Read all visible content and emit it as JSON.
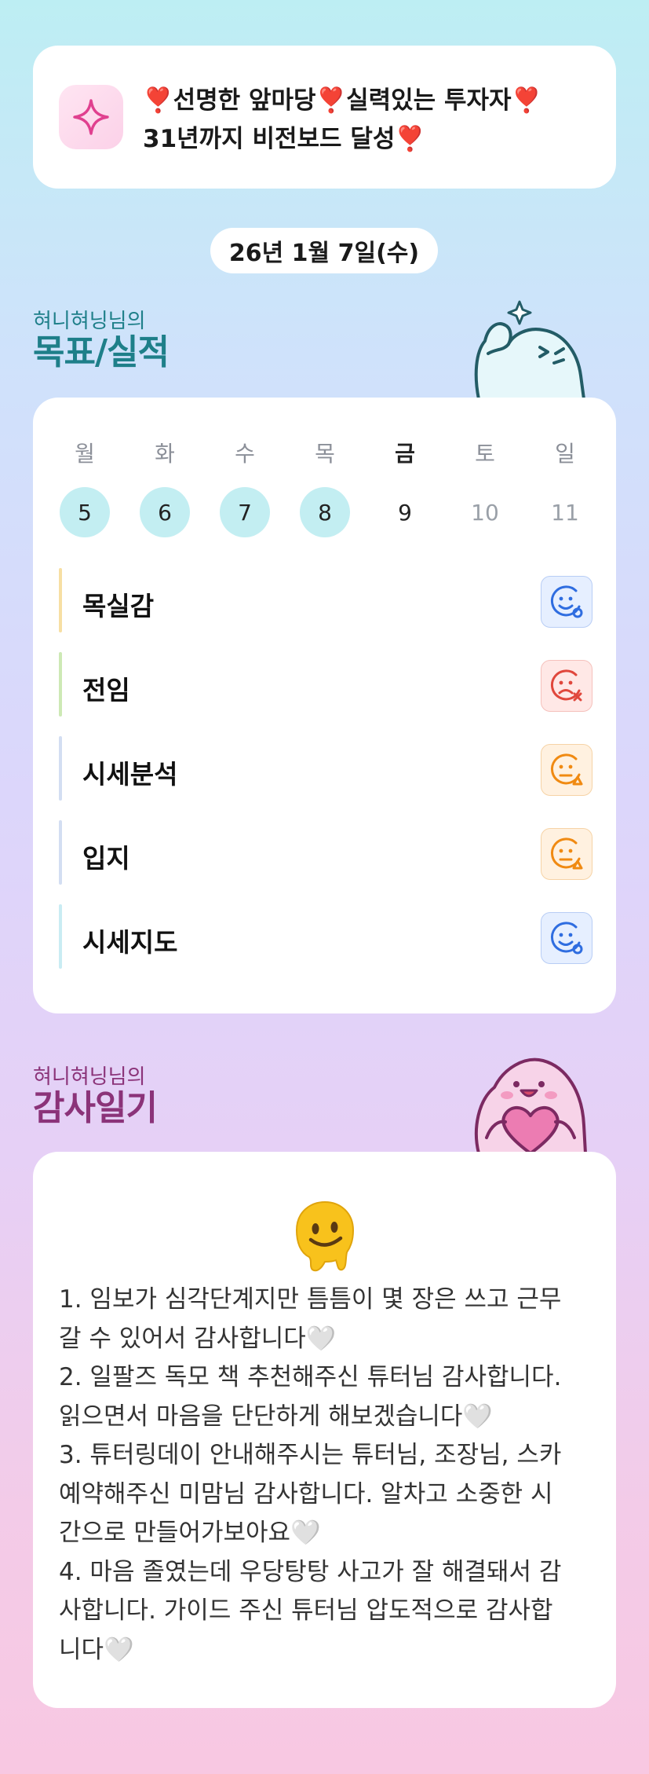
{
  "goal_banner": {
    "text": "❣️선명한 앞마당❣️실력있는 투자자❣️\n31년까지 비전보드 달성❣️"
  },
  "date_label": "26년 1월 7일(수)",
  "goal_section": {
    "owner_label": "혀니혀닝님의",
    "title": "목표/실적"
  },
  "week": {
    "days": [
      {
        "name": "월",
        "num": "5"
      },
      {
        "name": "화",
        "num": "6"
      },
      {
        "name": "수",
        "num": "7"
      },
      {
        "name": "목",
        "num": "8"
      },
      {
        "name": "금",
        "num": "9"
      },
      {
        "name": "토",
        "num": "10"
      },
      {
        "name": "일",
        "num": "11"
      }
    ]
  },
  "goals": [
    {
      "label": "목실감",
      "status": "good",
      "bar_color": "#f7dfa3"
    },
    {
      "label": "전임",
      "status": "bad",
      "bar_color": "#cde9b5"
    },
    {
      "label": "시세분석",
      "status": "mid",
      "bar_color": "#d3def2"
    },
    {
      "label": "입지",
      "status": "mid",
      "bar_color": "#d3def2"
    },
    {
      "label": "시세지도",
      "status": "good",
      "bar_color": "#c9ecf3"
    }
  ],
  "colors": {
    "good": "#2f6de0",
    "bad": "#e0473c",
    "mid": "#f08a12"
  },
  "diary_section": {
    "owner_label": "혀니혀닝님의",
    "title": "감사일기"
  },
  "diary": {
    "emoji_icon": "melting-face-icon",
    "text": "1. 임보가 심각단계지만 틈틈이 몇 장은 쓰고 근무\n갈 수 있어서 감사합니다🤍\n2. 일팔즈 독모 책 추천해주신 튜터님 감사합니다.\n읽으면서 마음을 단단하게 해보겠습니다🤍\n3. 튜터링데이 안내해주시는 튜터님, 조장님, 스카\n예약해주신 미맘님 감사합니다. 알차고 소중한 시\n간으로 만들어가보아요🤍\n4. 마음 졸였는데 우당탕탕 사고가 잘 해결돼서 감\n사합니다. 가이드 주신 튜터님 압도적으로 감사합\n니다🤍"
  }
}
